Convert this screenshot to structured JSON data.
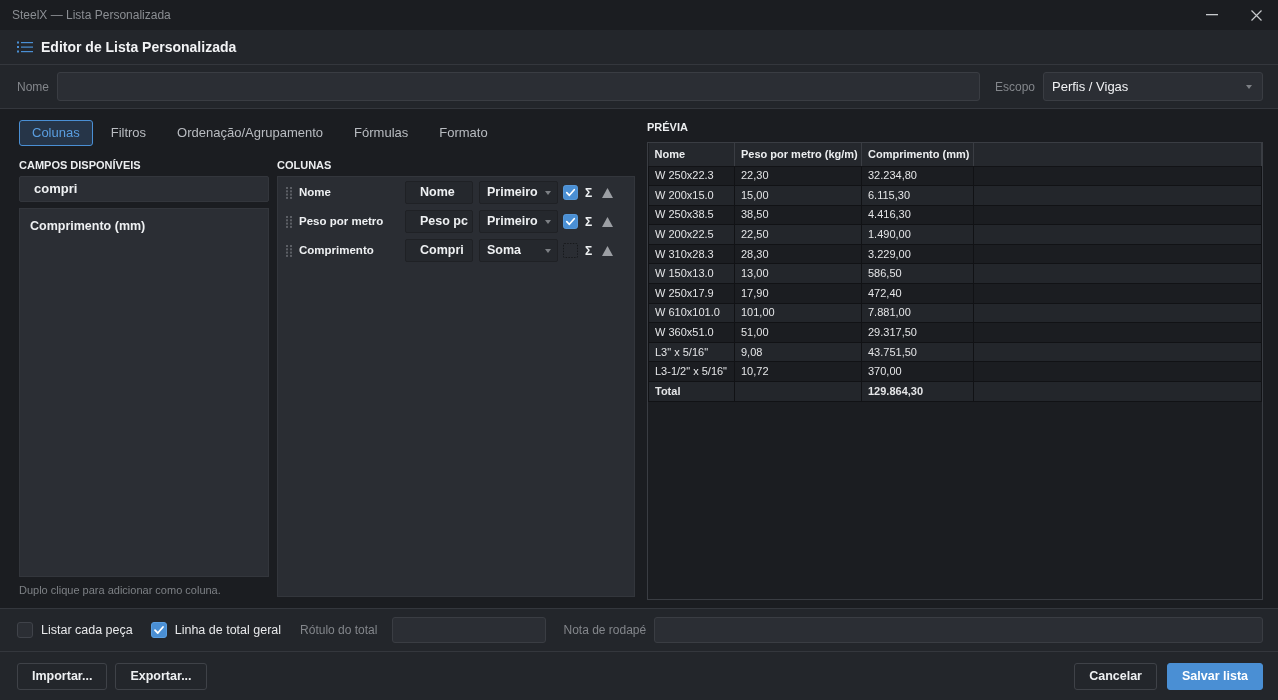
{
  "window": {
    "title": "SteelX — Lista Personalizada"
  },
  "header": {
    "title": "Editor de Lista Personalizada"
  },
  "name_field": {
    "label": "Nome"
  },
  "scope_field": {
    "label": "Escopo",
    "value": "Perfis / Vigas"
  },
  "tabs": [
    {
      "label": "Colunas",
      "selected": true
    },
    {
      "label": "Filtros",
      "selected": false
    },
    {
      "label": "Ordenação/Agrupamento",
      "selected": false
    },
    {
      "label": "Fórmulas",
      "selected": false
    },
    {
      "label": "Formato",
      "selected": false
    }
  ],
  "available_fields": {
    "heading": "CAMPOS DISPONÍVEIS",
    "search": {
      "value": "compri"
    },
    "items": [
      "Comprimento (mm)"
    ],
    "hint": "Duplo clique para adicionar como coluna."
  },
  "columns": {
    "heading": "COLUNAS",
    "rows": [
      {
        "name": "Nome",
        "header": "Nome",
        "aggregate": "Primeiro",
        "checked": true,
        "sum_symbol": "Σ"
      },
      {
        "name": "Peso por metro",
        "header": "Peso pc",
        "aggregate": "Primeiro",
        "checked": true,
        "sum_symbol": "Σ"
      },
      {
        "name": "Comprimento",
        "header": "Compri",
        "aggregate": "Soma",
        "checked": false,
        "sum_symbol": "Σ"
      }
    ]
  },
  "preview": {
    "heading": "PRÉVIA",
    "columns": [
      "Nome",
      "Peso por metro (kg/m)",
      "Comprimento (mm)"
    ],
    "rows": [
      [
        "W 250x22.3",
        "22,30",
        "32.234,80"
      ],
      [
        "W 200x15.0",
        "15,00",
        "6.115,30"
      ],
      [
        "W 250x38.5",
        "38,50",
        "4.416,30"
      ],
      [
        "W 200x22.5",
        "22,50",
        "1.490,00"
      ],
      [
        "W 310x28.3",
        "28,30",
        "3.229,00"
      ],
      [
        "W 150x13.0",
        "13,00",
        "586,50"
      ],
      [
        "W 250x17.9",
        "17,90",
        "472,40"
      ],
      [
        "W 610x101.0",
        "101,00",
        "7.881,00"
      ],
      [
        "W 360x51.0",
        "51,00",
        "29.317,50"
      ],
      [
        "L3\" x 5/16\"",
        "9,08",
        "43.751,50"
      ],
      [
        "L3-1/2\" x 5/16\"",
        "10,72",
        "370,00"
      ]
    ],
    "total": {
      "label": "Total",
      "comprimento": "129.864,30"
    }
  },
  "options": [
    {
      "label": "Listar cada peça",
      "checked": false
    },
    {
      "label": "Linha de total geral",
      "checked": true
    }
  ],
  "text_fields": [
    {
      "label": "Rótulo do total"
    },
    {
      "label": "Nota de rodapé"
    }
  ],
  "left_buttons": [
    "Importar...",
    "Exportar..."
  ],
  "right_buttons": [
    {
      "label": "Cancelar",
      "kind": "secondary"
    },
    {
      "label": "Salvar lista",
      "kind": "primary"
    }
  ]
}
